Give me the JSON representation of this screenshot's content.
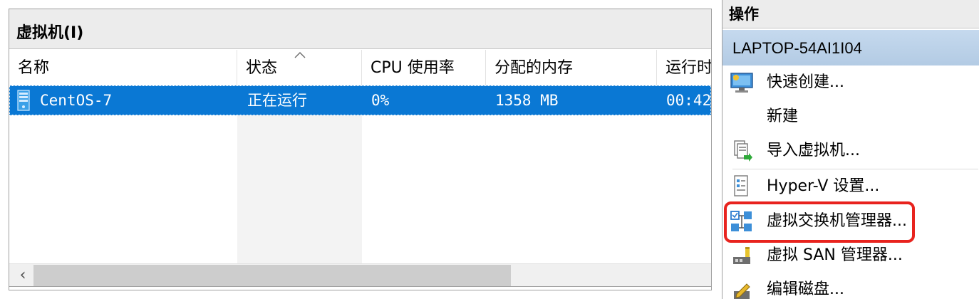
{
  "vm_panel": {
    "title": "虚拟机(I)",
    "columns": [
      "名称",
      "状态",
      "CPU 使用率",
      "分配的内存",
      "运行时"
    ],
    "rows": [
      {
        "name": "CentOS-7",
        "status": "正在运行",
        "cpu": "0%",
        "memory": "1358 MB",
        "uptime": "00:42:"
      }
    ],
    "scroll_left_glyph": "‹"
  },
  "actions_panel": {
    "title": "操作",
    "host": "LAPTOP-54AI1I04",
    "items": [
      {
        "label": "快速创建...",
        "icon": "quick-create-monitor-icon"
      },
      {
        "label": "新建",
        "icon": "none"
      },
      {
        "label": "导入虚拟机...",
        "icon": "import-vm-icon"
      },
      {
        "label": "Hyper-V 设置...",
        "icon": "settings-document-icon"
      },
      {
        "label": "虚拟交换机管理器...",
        "icon": "virtual-switch-icon"
      },
      {
        "label": "虚拟 SAN 管理器...",
        "icon": "virtual-san-icon"
      },
      {
        "label": "编辑磁盘...",
        "icon": "edit-disk-icon"
      }
    ],
    "highlighted_item": "虚拟交换机管理器..."
  },
  "colors": {
    "selection": "#0a78d4",
    "host_header": "#b3cbe4",
    "highlight_border": "#e8231e"
  }
}
